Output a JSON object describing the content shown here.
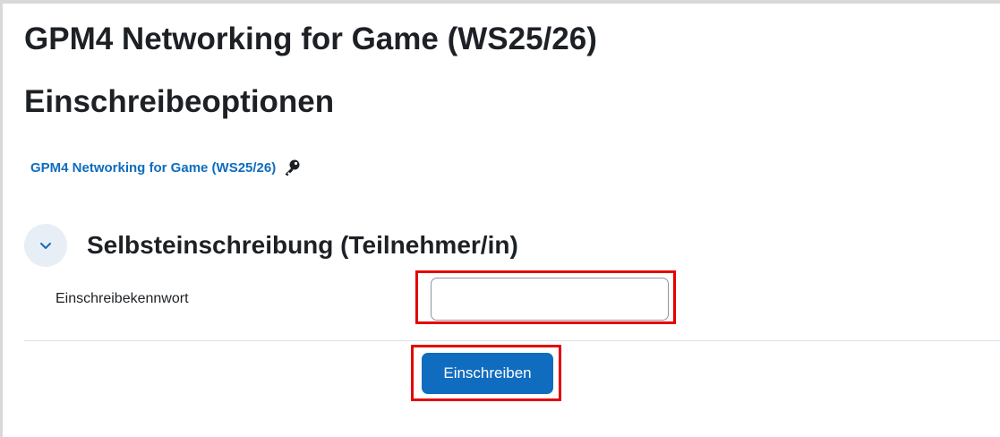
{
  "course": {
    "title": "GPM4 Networking for Game (WS25/26)"
  },
  "page": {
    "heading": "Einschreibeoptionen"
  },
  "course_link": {
    "label": "GPM4 Networking for Game (WS25/26)",
    "icon": "key-icon"
  },
  "self_enrolment": {
    "section_title": "Selbsteinschreibung (Teilnehmer/in)",
    "collapse_icon": "chevron-down-icon",
    "password_label": "Einschreibekennwort",
    "password_value": "",
    "submit_label": "Einschreiben"
  },
  "colors": {
    "link": "#0f6cbf",
    "primary_button": "#0f6cbf",
    "highlight": "#e60000",
    "collapse_bg": "#e8eef6"
  }
}
